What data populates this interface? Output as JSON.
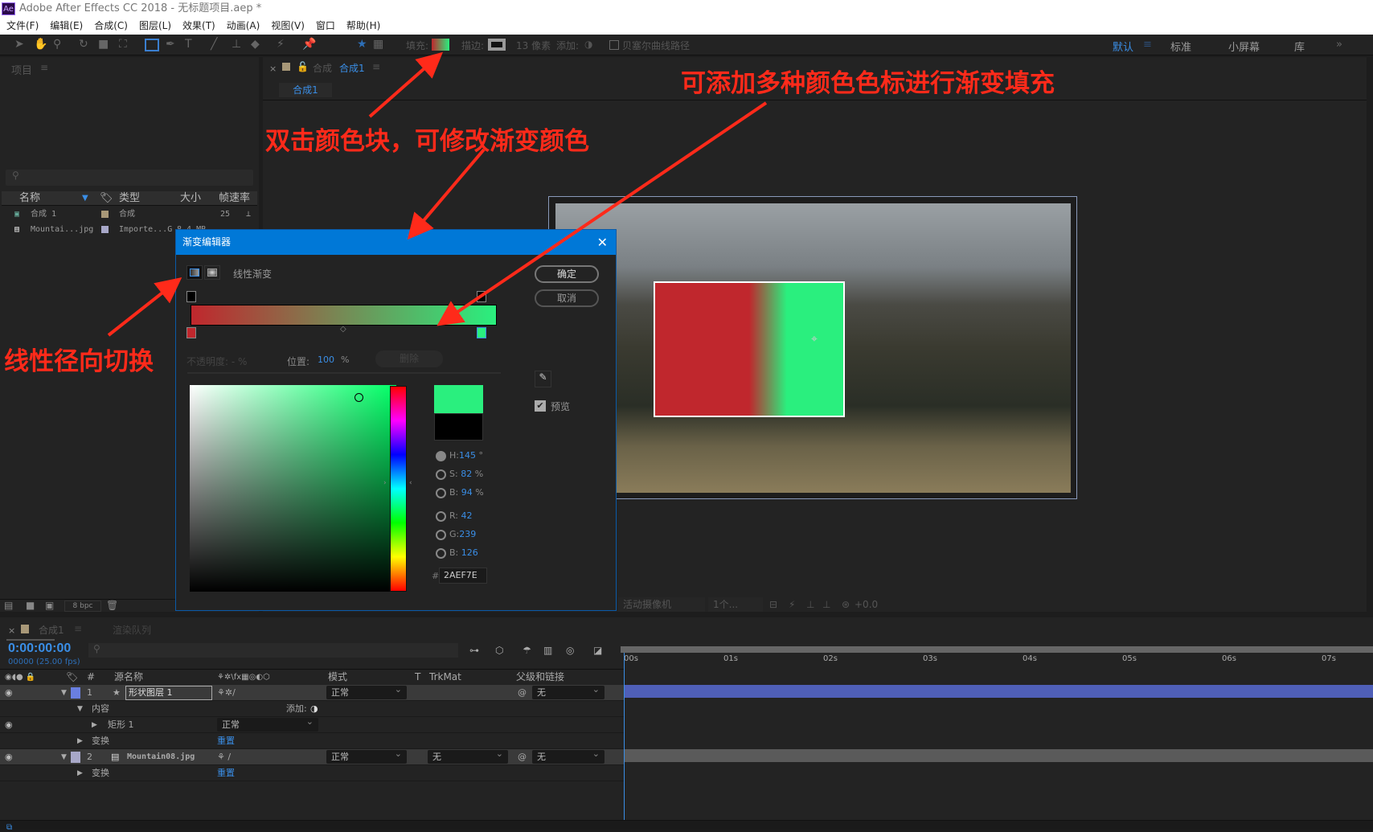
{
  "app": {
    "logo": "Ae",
    "title": "Adobe After Effects CC 2018 - 无标题项目.aep *"
  },
  "menu": [
    "文件(F)",
    "编辑(E)",
    "合成(C)",
    "图层(L)",
    "效果(T)",
    "动画(A)",
    "视图(V)",
    "窗口",
    "帮助(H)"
  ],
  "toolbar": {
    "fill_label": "填充:",
    "stroke_label": "描边:",
    "stroke_px": "13 像素",
    "add_label": "添加:",
    "bezier_label": "贝塞尔曲线路径",
    "workspaces": [
      "默认",
      "标准",
      "小屏幕",
      "库"
    ],
    "active_workspace": "默认"
  },
  "project": {
    "title": "项目",
    "columns": [
      "名称",
      "类型",
      "大小",
      "帧速率"
    ],
    "items": [
      {
        "name": "合成 1",
        "type": "合成",
        "size": "",
        "fps": "25",
        "label_color": "#a89878"
      },
      {
        "name": "Mountai...jpg",
        "type": "Importe...G",
        "size": "8.4 MB",
        "fps": "",
        "label_color": "#a8a8c8"
      }
    ],
    "bpc": "8 bpc"
  },
  "viewer": {
    "tab_prefix": "合成",
    "tab_name": "合成1",
    "breadcrumb": "合成1",
    "camera": "活动摄像机",
    "views": "1个...",
    "exposure": "+0.0"
  },
  "dialog": {
    "title": "渐变编辑器",
    "mode_label": "线性渐变",
    "ok": "确定",
    "cancel": "取消",
    "opacity_label": "不透明度:",
    "opacity_value": "-",
    "pct": "%",
    "position_label": "位置:",
    "position_value": "100",
    "delete": "删除",
    "preview": "预览",
    "preview_checked": true,
    "hsb": [
      {
        "k": "H:",
        "v": "145",
        "u": "°"
      },
      {
        "k": "S:",
        "v": "82",
        "u": "%"
      },
      {
        "k": "B:",
        "v": "94",
        "u": "%"
      }
    ],
    "rgb": [
      {
        "k": "R:",
        "v": "42"
      },
      {
        "k": "G:",
        "v": "239"
      },
      {
        "k": "B:",
        "v": "126"
      }
    ],
    "hex_prefix": "#",
    "hex": "2AEF7E",
    "stop_start": "#c0272d",
    "stop_end": "#2aef7e"
  },
  "timeline": {
    "tab": "合成1",
    "render_queue": "渲染队列",
    "timecode": "0:00:00:00",
    "fps": "00000 (25.00 fps)",
    "headers": {
      "name": "源名称",
      "mode": "模式",
      "t": "T",
      "trkmat": "TrkMat",
      "parent": "父级和链接"
    },
    "layers": [
      {
        "num": "1",
        "name": "形状图层 1",
        "mode": "正常",
        "parent": "无",
        "color": "#6a7fe0"
      },
      {
        "num": "2",
        "name": "Mountain08.jpg",
        "mode": "正常",
        "trkmat": "无",
        "parent": "无",
        "color": "#a8a8c8"
      }
    ],
    "contents": "内容",
    "add": "添加:",
    "rect": "矩形 1",
    "rect_mode": "正常",
    "transform": "变换",
    "reset": "重置",
    "ruler": [
      "00s",
      "01s",
      "02s",
      "03s",
      "04s",
      "05s",
      "06s",
      "07s"
    ]
  },
  "annotations": [
    "可添加多种颜色色标进行渐变填充",
    "双击颜色块，可修改渐变颜色",
    "线性径向切换"
  ],
  "colors": {
    "accent": "#0078d7",
    "annotation": "#ff2a1a",
    "gradient_green": "#2aef7e",
    "gradient_red": "#c0272d"
  }
}
